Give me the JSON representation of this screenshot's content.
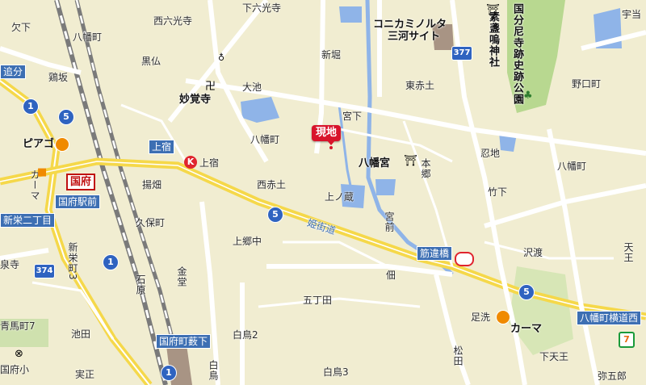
{
  "title": "現地",
  "labels": {
    "kudashi": "欠下",
    "hachimancho_nw": "八幡町",
    "nishirokko": "西六光寺",
    "shimorokkoji": "下六光寺",
    "konica": "コニカミノルタ",
    "mikawa_site": "三河サイト",
    "sosan": "素盞嗚神社",
    "kokubun": "国分尼寺跡史跡公園",
    "usau": "宇当",
    "oikebun": "追分",
    "hatosaka": "鶏坂",
    "kurobotoke": "黒仏",
    "shinbori": "新堀",
    "myokakuji": "妙覚寺",
    "oike": "大池",
    "higashiakatsuchi": "東赤土",
    "noguchicho": "野口町",
    "miyashita": "宮下",
    "hachimancho_c": "八幡町",
    "piago": "ピアゴ",
    "kokufu_station": "国府",
    "kamiyado_box": "上宿",
    "kamiyado": "上宿",
    "hachimangu": "八幡宮",
    "oshiike": "忍地",
    "hachimancho_e": "八幡町",
    "kama_w": "カーマ",
    "kokufu_ekimae": "国府駅前",
    "agebata": "揚畑",
    "nishiakatsuchi": "西赤土",
    "kaminokura": "上ノ蔵",
    "hongo": "本郷",
    "takeshita": "竹下",
    "shinsakae2": "新栄二丁目",
    "kuhocho": "久保町",
    "himekaido": "姫街道",
    "miyamae": "宮前",
    "kamigonaka": "上郷中",
    "sawatari": "沢渡",
    "tenou": "天王",
    "ryusenji": "泉寺",
    "shinsakae3": "新栄町3",
    "kanedo": "金堂",
    "ishihara": "石原",
    "hata": "佃",
    "sujikaibashi": "筋違橋",
    "ashiarai": "足洗",
    "gochoda": "五丁田",
    "kama_e": "カーマ",
    "yawata_yokomichi": "八幡町横道西",
    "aomacho": "青馬町7",
    "ikeda": "池田",
    "kokufu_yabushita": "国府町薮下",
    "shiratori2": "白鳥2",
    "matsuda": "松田",
    "shimotenou": "下天王",
    "kokufusho": "国府小",
    "jissho": "実正",
    "shiratori3": "白鳥3",
    "shirato": "白鳥",
    "yagoro": "弥五郎"
  },
  "routes": {
    "r1a": "1",
    "r1b": "1",
    "r1c": "1",
    "r5a": "5",
    "r5b": "5",
    "r5c": "5",
    "r374": "374",
    "r377": "377"
  }
}
